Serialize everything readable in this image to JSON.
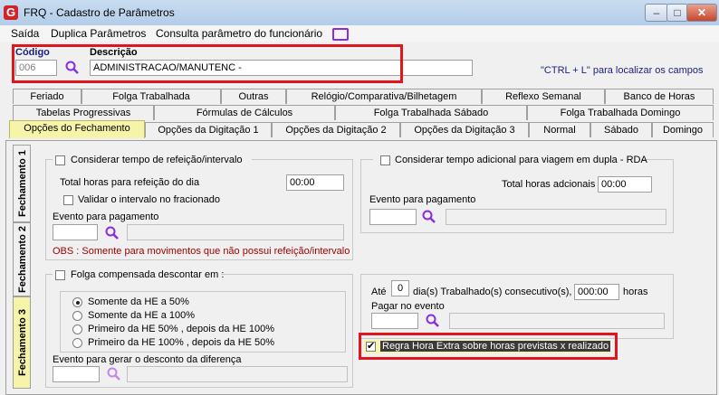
{
  "window": {
    "title": "FRQ - Cadastro de Parâmetros",
    "icon": "app-logo-icon"
  },
  "menu": {
    "items": [
      "Saída",
      "Duplica Parâmetros",
      "Consulta parâmetro do funcionário"
    ],
    "extra_icon": "monitor-icon"
  },
  "header": {
    "codigo_label": "Código",
    "codigo_value": "006",
    "descricao_label": "Descrição",
    "descricao_value": "ADMINISTRACAO/MANUTENC -",
    "hint": "\"CTRL + L\" para localizar os campos"
  },
  "tabs": {
    "row1": [
      "Feriado",
      "Folga Trabalhada",
      "Outras",
      "Relógio/Comparativa/Bilhetagem",
      "Reflexo Semanal",
      "Banco de Horas"
    ],
    "row2": [
      "Tabelas Progressivas",
      "Fórmulas de Cálculos",
      "Folga Trabalhada Sábado",
      "Folga Trabalhada Domingo"
    ],
    "row3": [
      "Opções do Fechamento",
      "Opções da Digitação 1",
      "Opções da Digitação 2",
      "Opções da Digitação 3",
      "Normal",
      "Sábado",
      "Domingo"
    ],
    "vertical": [
      "Fechamento 1",
      "Fechamento 2",
      "Fechamento 3"
    ]
  },
  "group_refeicao": {
    "title": "Considerar tempo de refeição/intervalo",
    "total_label": "Total horas para refeição do dia",
    "total_value": "00:00",
    "validar_label": "Validar o intervalo no fracionado",
    "evento_label": "Evento para pagamento",
    "obs": "OBS : Somente para movimentos que não possui refeição/intervalo"
  },
  "group_rda": {
    "title": "Considerar tempo adicional para viagem em dupla - RDA",
    "total_label": "Total horas adcionais",
    "total_value": "00:00",
    "evento_label": "Evento para pagamento"
  },
  "group_folga": {
    "title": "Folga compensada descontar em :",
    "options": [
      "Somente da HE a 50%",
      "Somente da HE a 100%",
      "Primeiro da HE 50% , depois da HE 100%",
      "Primeiro da HE 100% , depois da HE 50%"
    ],
    "selected_index": 0,
    "evento_label": "Evento para gerar o desconto da diferença"
  },
  "group_dias": {
    "ate_label": "Até",
    "dias_value": "0",
    "dias_label": "dia(s) Trabalhado(s) consecutivo(s),",
    "horas_value": "000:00",
    "horas_label": "horas",
    "pagar_label": "Pagar no evento"
  },
  "regra": {
    "label": "Regra Hora Extra sobre horas previstas x realizado",
    "checked": true
  },
  "colors": {
    "accent_red": "#e0161d",
    "active_tab": "#f5f4a8",
    "hint_blue": "#1a237e",
    "obs_red": "#a00000"
  }
}
